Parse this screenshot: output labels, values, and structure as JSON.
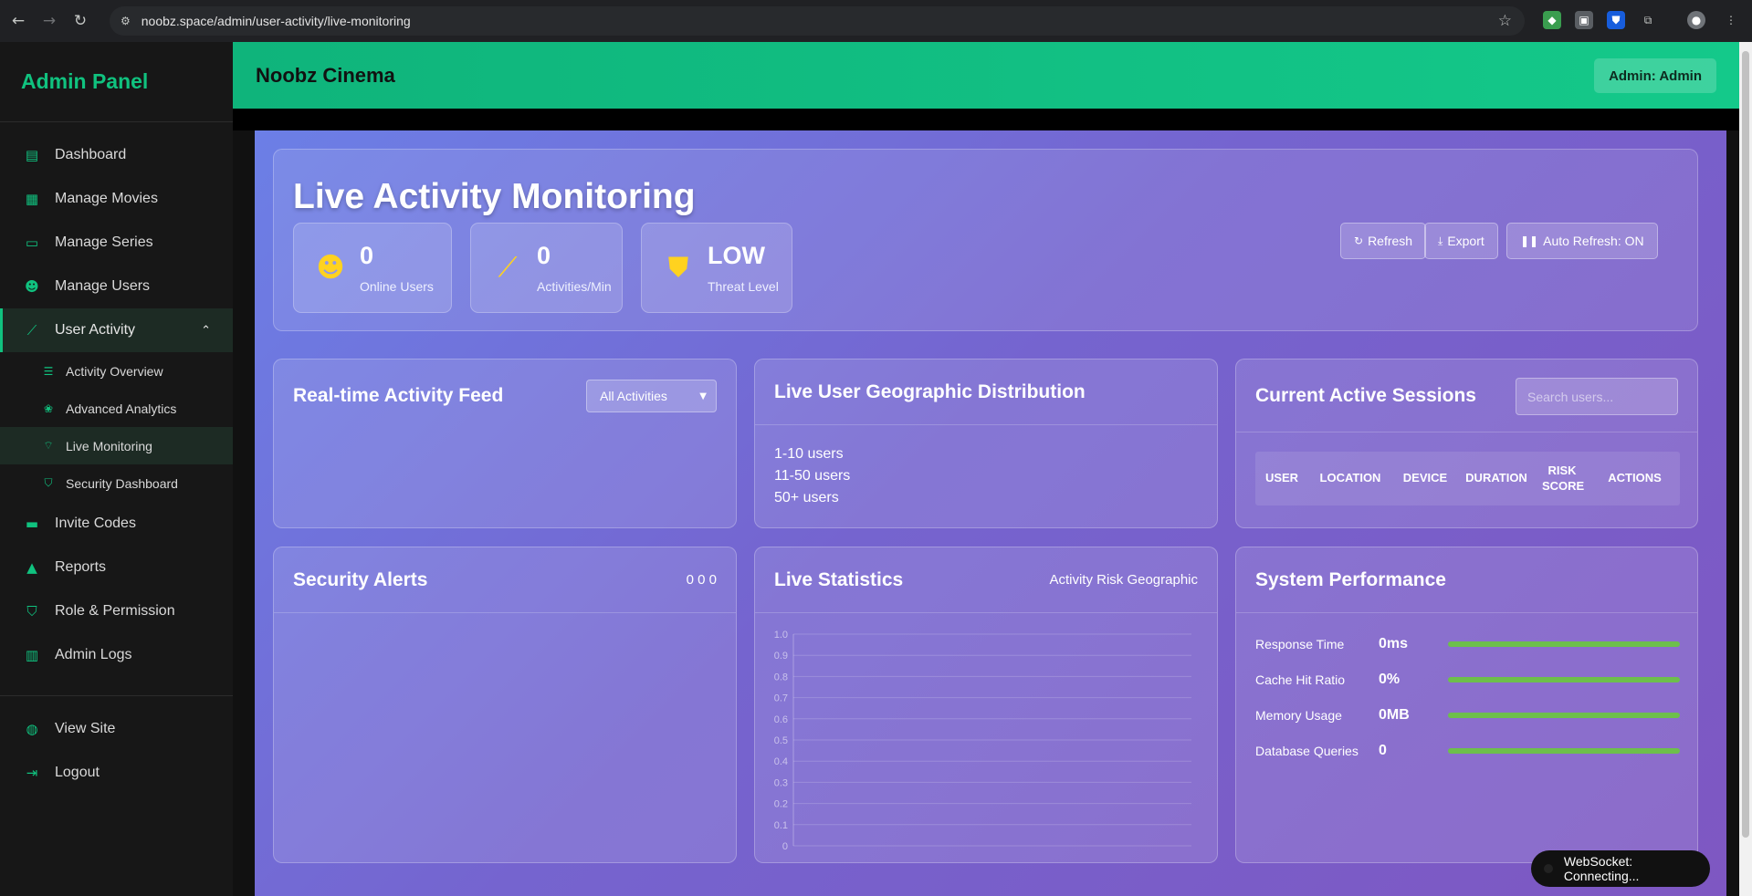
{
  "browser": {
    "url": "noobz.space/admin/user-activity/live-monitoring"
  },
  "sidebar": {
    "brand": "Admin Panel",
    "items": [
      {
        "label": "Dashboard",
        "icon": "chart-bar-icon"
      },
      {
        "label": "Manage Movies",
        "icon": "film-icon"
      },
      {
        "label": "Manage Series",
        "icon": "tv-icon"
      },
      {
        "label": "Manage Users",
        "icon": "users-icon"
      },
      {
        "label": "User Activity",
        "icon": "chart-line-icon"
      }
    ],
    "sub_items": [
      {
        "label": "Activity Overview",
        "icon": "list-icon"
      },
      {
        "label": "Advanced Analytics",
        "icon": "brain-icon"
      },
      {
        "label": "Live Monitoring",
        "icon": "satellite-icon"
      },
      {
        "label": "Security Dashboard",
        "icon": "shield-icon"
      }
    ],
    "items2": [
      {
        "label": "Invite Codes",
        "icon": "ticket-icon"
      },
      {
        "label": "Reports",
        "icon": "warning-icon"
      },
      {
        "label": "Role & Permission",
        "icon": "shield-icon"
      },
      {
        "label": "Admin Logs",
        "icon": "clipboard-icon"
      }
    ],
    "footer": [
      {
        "label": "View Site",
        "icon": "globe-icon"
      },
      {
        "label": "Logout",
        "icon": "logout-icon"
      }
    ]
  },
  "header": {
    "site_title": "Noobz Cinema",
    "admin_label": "Admin: Admin"
  },
  "hero": {
    "title": "Live Activity Monitoring",
    "stats": [
      {
        "value": "0",
        "label": "Online Users",
        "icon": "users-icon"
      },
      {
        "value": "0",
        "label": "Activities/Min",
        "icon": "chart-line-icon"
      },
      {
        "value": "LOW",
        "label": "Threat Level",
        "icon": "shield-icon"
      }
    ],
    "buttons": {
      "refresh": "Refresh",
      "export": "Export",
      "auto_refresh": "Auto Refresh: ON"
    }
  },
  "feed": {
    "title": "Real-time Activity Feed",
    "filter_value": "All Activities"
  },
  "geo": {
    "title": "Live User Geographic Distribution",
    "legend": [
      "1-10 users",
      "11-50 users",
      "50+ users"
    ]
  },
  "sessions": {
    "title": "Current Active Sessions",
    "search_placeholder": "Search users...",
    "columns": [
      "USER",
      "LOCATION",
      "DEVICE",
      "DURATION",
      "RISK SCORE",
      "ACTIONS"
    ]
  },
  "alerts": {
    "title": "Security Alerts",
    "counts": "0 0 0"
  },
  "live_stats": {
    "title": "Live Statistics",
    "tabs": "Activity Risk Geographic"
  },
  "chart_data": {
    "type": "line",
    "x": [],
    "series": [],
    "yticks": [
      "1.0",
      "0.9",
      "0.8",
      "0.7",
      "0.6",
      "0.5",
      "0.4",
      "0.3",
      "0.2",
      "0.1",
      "0"
    ],
    "ylim": [
      0,
      1.0
    ],
    "grid": true
  },
  "performance": {
    "title": "System Performance",
    "rows": [
      {
        "label": "Response Time",
        "value": "0ms",
        "level": 100
      },
      {
        "label": "Cache Hit Ratio",
        "value": "0%",
        "level": 100
      },
      {
        "label": "Memory Usage",
        "value": "0MB",
        "level": 100
      },
      {
        "label": "Database Queries",
        "value": "0",
        "level": 100
      }
    ]
  },
  "websocket": {
    "status": "WebSocket: Connecting..."
  },
  "colors": {
    "accent": "#10c27f",
    "stat_icon": "#ffd21f",
    "perf_bar": "#6dbf4b"
  }
}
